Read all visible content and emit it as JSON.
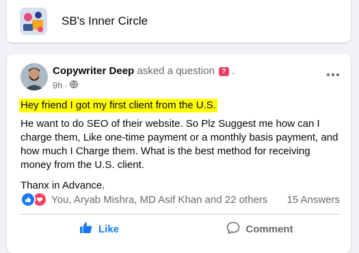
{
  "group": {
    "name": "SB's Inner Circle"
  },
  "post": {
    "author": "Copywriter Deep",
    "action": "asked a question",
    "action_suffix": ".",
    "time": "9h",
    "time_separator": "·",
    "question_icon": "?",
    "highlight": "Hey friend I got my first client from the U.S.",
    "body": "He want to do SEO of their website. So Plz Suggest me how can I charge them, Like one-time payment or a monthly basis payment, and how much I Charge them. What is the best method for receiving money from the U.S. client.",
    "thanks": "Thanx in Advance.",
    "reactors": "You, Aryab Mishra, MD Asif Khan and 22 others",
    "answers": "15 Answers"
  },
  "actions": {
    "like": "Like",
    "comment": "Comment"
  },
  "colors": {
    "accent": "#1877f2",
    "love": "#f33e58",
    "highlight": "#ffff00",
    "question_badge": "#e4405f"
  },
  "icons": {
    "like": "thumbs-up-icon",
    "comment": "speech-bubble-icon",
    "privacy": "globe-icon",
    "more": "more-horizontal-icon"
  }
}
